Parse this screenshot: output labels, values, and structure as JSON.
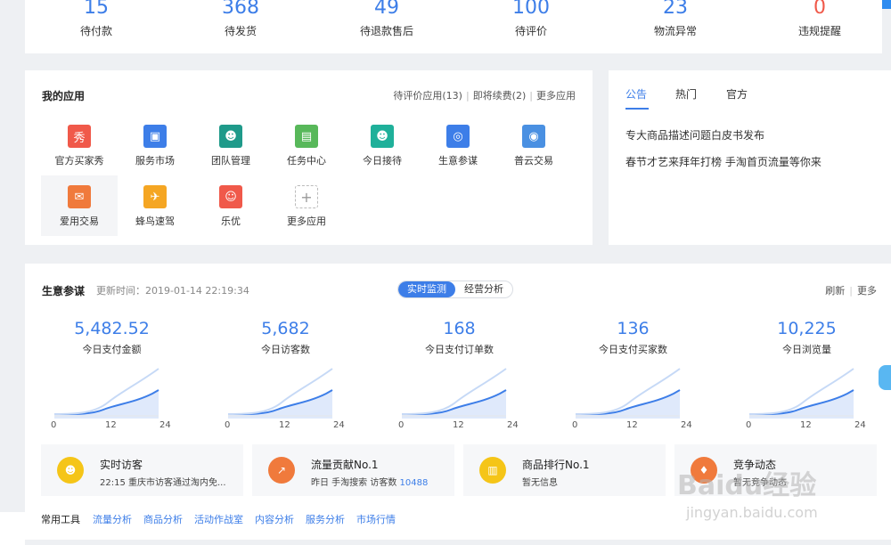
{
  "stats": [
    {
      "num": "15",
      "label": "待付款"
    },
    {
      "num": "368",
      "label": "待发货"
    },
    {
      "num": "49",
      "label": "待退款售后"
    },
    {
      "num": "100",
      "label": "待评价"
    },
    {
      "num": "23",
      "label": "物流异常"
    },
    {
      "num": "0",
      "label": "违规提醒"
    }
  ],
  "apps": {
    "title": "我的应用",
    "links": [
      "待评价应用(13)",
      "即将续费(2)",
      "更多应用"
    ],
    "items": [
      {
        "name": "官方买家秀",
        "color": "#f0594a",
        "glyph": "秀"
      },
      {
        "name": "服务市场",
        "color": "#3d7ee8",
        "glyph": "▣"
      },
      {
        "name": "团队管理",
        "color": "#1f9a8a",
        "glyph": "☻"
      },
      {
        "name": "任务中心",
        "color": "#58b85a",
        "glyph": "▤"
      },
      {
        "name": "今日接待",
        "color": "#1fb09a",
        "glyph": "☻"
      },
      {
        "name": "生意参谋",
        "color": "#3d7ee8",
        "glyph": "◎"
      },
      {
        "name": "普云交易",
        "color": "#4a90e2",
        "glyph": "◉"
      },
      {
        "name": "爱用交易",
        "color": "#f07a3c",
        "glyph": "✉"
      },
      {
        "name": "蜂鸟速驾",
        "color": "#f5a623",
        "glyph": "✈"
      },
      {
        "name": "乐优",
        "color": "#f0594a",
        "glyph": "☺"
      },
      {
        "name": "更多应用",
        "color": "#ffffff",
        "glyph": "+"
      }
    ]
  },
  "announce": {
    "tabs": [
      "公告",
      "热门",
      "官方"
    ],
    "news": [
      "专大商品描述问题白皮书发布",
      "春节才艺来拜年打榜 手淘首页流量等你来"
    ]
  },
  "biz": {
    "title": "生意参谋",
    "update": "更新时间：2019-01-14 22:19:34",
    "seg": [
      "实时监测",
      "经营分析"
    ],
    "right": [
      "刷新",
      "更多"
    ],
    "metrics": [
      {
        "val": "5,482.52",
        "label": "今日支付金额"
      },
      {
        "val": "5,682",
        "label": "今日访客数"
      },
      {
        "val": "168",
        "label": "今日支付订单数"
      },
      {
        "val": "136",
        "label": "今日支付买家数"
      },
      {
        "val": "10,225",
        "label": "今日浏览量"
      }
    ],
    "axis": [
      "0",
      "12",
      "24"
    ],
    "summaries": [
      {
        "title": "实时访客",
        "desc": "22:15 重庆市访客通过淘内免...",
        "extra": "",
        "color": "#f5c518",
        "glyph": "☻"
      },
      {
        "title": "流量贡献No.1",
        "desc": "昨日 手淘搜索 访客数 ",
        "extra": "10488",
        "color": "#f07a3c",
        "glyph": "↗"
      },
      {
        "title": "商品排行No.1",
        "desc": "暂无信息",
        "extra": "",
        "color": "#f5c518",
        "glyph": "▥"
      },
      {
        "title": "竞争动态",
        "desc": "暂无竞争动态",
        "extra": "",
        "color": "#f07a3c",
        "glyph": "♦"
      }
    ],
    "tools_label": "常用工具",
    "tools": [
      "流量分析",
      "商品分析",
      "活动作战室",
      "内容分析",
      "服务分析",
      "市场行情"
    ]
  },
  "watermark": {
    "main": "Baidu经验",
    "sub": "jingyan.baidu.com"
  }
}
